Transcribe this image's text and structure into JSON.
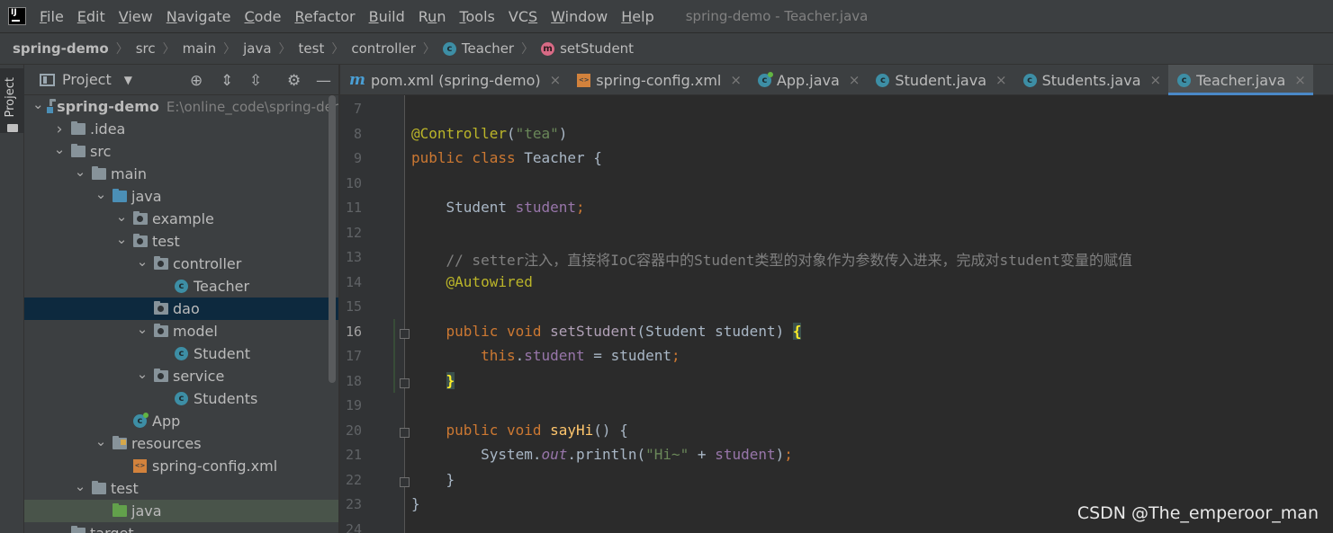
{
  "menubar": {
    "items": [
      {
        "label": "File",
        "mnemonic": "F"
      },
      {
        "label": "Edit",
        "mnemonic": "E"
      },
      {
        "label": "View",
        "mnemonic": "V"
      },
      {
        "label": "Navigate",
        "mnemonic": "N"
      },
      {
        "label": "Code",
        "mnemonic": "C"
      },
      {
        "label": "Refactor",
        "mnemonic": "R"
      },
      {
        "label": "Build",
        "mnemonic": "B"
      },
      {
        "label": "Run",
        "mnemonic": "u"
      },
      {
        "label": "Tools",
        "mnemonic": "T"
      },
      {
        "label": "VCS",
        "mnemonic": "S"
      },
      {
        "label": "Window",
        "mnemonic": "W"
      },
      {
        "label": "Help",
        "mnemonic": "H"
      }
    ],
    "window_title": "spring-demo - Teacher.java"
  },
  "breadcrumb": {
    "items": [
      "spring-demo",
      "src",
      "main",
      "java",
      "test",
      "controller",
      "Teacher",
      "setStudent"
    ]
  },
  "tool_strip": {
    "label": "Project"
  },
  "project_panel": {
    "title": "Project",
    "tree": [
      {
        "label": "spring-demo",
        "hint": "E:\\online_code\\spring-der",
        "icon": "module-folder",
        "expanded": true
      },
      {
        "label": ".idea",
        "icon": "folder",
        "expanded": false
      },
      {
        "label": "src",
        "icon": "folder",
        "expanded": true
      },
      {
        "label": "main",
        "icon": "folder",
        "expanded": true
      },
      {
        "label": "java",
        "icon": "source-folder",
        "expanded": true
      },
      {
        "label": "example",
        "icon": "package",
        "expanded": true
      },
      {
        "label": "test",
        "icon": "package",
        "expanded": true
      },
      {
        "label": "controller",
        "icon": "package",
        "expanded": true
      },
      {
        "label": "Teacher",
        "icon": "class"
      },
      {
        "label": "dao",
        "icon": "package"
      },
      {
        "label": "model",
        "icon": "package",
        "expanded": true
      },
      {
        "label": "Student",
        "icon": "class"
      },
      {
        "label": "service",
        "icon": "package",
        "expanded": true
      },
      {
        "label": "Students",
        "icon": "class"
      },
      {
        "label": "App",
        "icon": "app-class"
      },
      {
        "label": "resources",
        "icon": "resources-folder",
        "expanded": true
      },
      {
        "label": "spring-config.xml",
        "icon": "xml-file"
      },
      {
        "label": "test",
        "icon": "folder",
        "expanded": true
      },
      {
        "label": "java",
        "icon": "test-folder"
      },
      {
        "label": "target",
        "icon": "folder"
      }
    ]
  },
  "editor_tabs": [
    {
      "label": "pom.xml (spring-demo)",
      "icon": "maven-icon"
    },
    {
      "label": "spring-config.xml",
      "icon": "xml-file-icon"
    },
    {
      "label": "App.java",
      "icon": "app-class-icon"
    },
    {
      "label": "Student.java",
      "icon": "class-icon"
    },
    {
      "label": "Students.java",
      "icon": "class-icon"
    },
    {
      "label": "Teacher.java",
      "icon": "class-icon",
      "active": true
    }
  ],
  "editor": {
    "current_line": 16,
    "lines": [
      {
        "no": "7",
        "tokens": []
      },
      {
        "no": "8",
        "tokens": [
          {
            "t": "ann",
            "v": "@Controller"
          },
          {
            "t": "p",
            "v": "("
          },
          {
            "t": "str",
            "v": "\"tea\""
          },
          {
            "t": "p",
            "v": ")"
          }
        ]
      },
      {
        "no": "9",
        "tokens": [
          {
            "t": "kw",
            "v": "public class "
          },
          {
            "t": "p",
            "v": "Teacher {"
          }
        ]
      },
      {
        "no": "10",
        "tokens": []
      },
      {
        "no": "11",
        "tokens": [
          {
            "t": "p",
            "v": "    Student "
          },
          {
            "t": "fld",
            "v": "student"
          },
          {
            "t": "kw",
            "v": ";"
          }
        ]
      },
      {
        "no": "12",
        "tokens": []
      },
      {
        "no": "13",
        "tokens": [
          {
            "t": "cmt",
            "v": "    // setter注入，直接将IoC容器中的Student类型的对象作为参数传入进来，完成对student变量的赋值"
          }
        ]
      },
      {
        "no": "14",
        "tokens": [
          {
            "t": "ann",
            "v": "    @Autowired"
          }
        ]
      },
      {
        "no": "15",
        "tokens": []
      },
      {
        "no": "16",
        "tokens": [
          {
            "t": "kw",
            "v": "    public void "
          },
          {
            "t": "mth-dim",
            "v": "setStudent"
          },
          {
            "t": "p",
            "v": "(Student student) "
          },
          {
            "t": "brace",
            "v": "{"
          }
        ]
      },
      {
        "no": "17",
        "tokens": [
          {
            "t": "kw",
            "v": "        this"
          },
          {
            "t": "p",
            "v": "."
          },
          {
            "t": "fld",
            "v": "student"
          },
          {
            "t": "p",
            "v": " = student"
          },
          {
            "t": "kw",
            "v": ";"
          }
        ]
      },
      {
        "no": "18",
        "tokens": [
          {
            "t": "brace",
            "v": "    }"
          }
        ]
      },
      {
        "no": "19",
        "tokens": []
      },
      {
        "no": "20",
        "tokens": [
          {
            "t": "kw",
            "v": "    public void "
          },
          {
            "t": "mth",
            "v": "sayHi"
          },
          {
            "t": "p",
            "v": "() {"
          }
        ]
      },
      {
        "no": "21",
        "tokens": [
          {
            "t": "p",
            "v": "        System."
          },
          {
            "t": "stat",
            "v": "out"
          },
          {
            "t": "p",
            "v": ".println("
          },
          {
            "t": "str",
            "v": "\"Hi~\""
          },
          {
            "t": "p",
            "v": " + "
          },
          {
            "t": "fld",
            "v": "student"
          },
          {
            "t": "p",
            "v": ")"
          },
          {
            "t": "kw",
            "v": ";"
          }
        ]
      },
      {
        "no": "22",
        "tokens": [
          {
            "t": "p",
            "v": "    }"
          }
        ]
      },
      {
        "no": "23",
        "tokens": [
          {
            "t": "p",
            "v": "}"
          }
        ]
      },
      {
        "no": "24",
        "tokens": []
      }
    ]
  },
  "watermark": "CSDN @The_emperoor_man",
  "colors": {
    "background": "#2b2b2b",
    "panel": "#3c3f41",
    "keyword": "#cc7832",
    "annotation": "#bbb529",
    "string": "#6a8759",
    "field": "#9876aa",
    "comment": "#808080",
    "method": "#ffc66d",
    "selection": "#0d293e",
    "accent": "#4a88c7"
  }
}
